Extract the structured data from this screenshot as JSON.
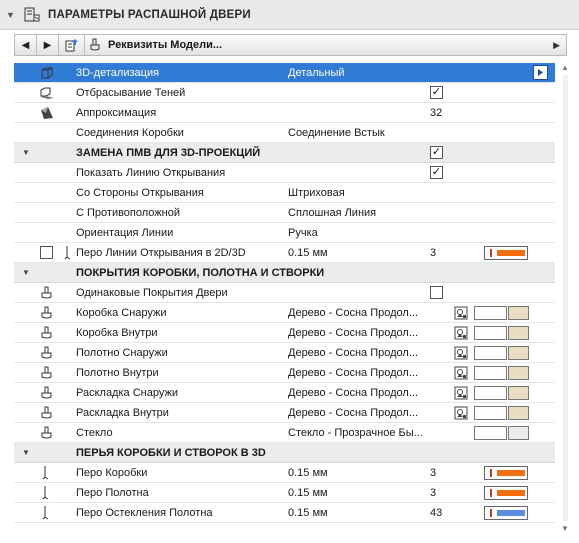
{
  "header": {
    "title": "ПАРАМЕТРЫ РАСПАШНОЙ ДВЕРИ"
  },
  "toolbar": {
    "combo_label": "Реквизиты Модели..."
  },
  "rows": [
    {
      "type": "item",
      "name": "3D-детализация",
      "value": "Детальный",
      "icon": "cube-icon",
      "selected": true
    },
    {
      "type": "item",
      "name": "Отбрасывание Теней",
      "icon": "shadow-cube-icon",
      "checkbox": true
    },
    {
      "type": "item",
      "name": "Аппроксимация",
      "icon": "approximation-icon",
      "num": "32"
    },
    {
      "type": "item",
      "name": "Соединения Коробки",
      "value": "Соединение Встык"
    },
    {
      "type": "section",
      "name": "ЗАМЕНА ПМВ ДЛЯ 3D-ПРОЕКЦИЙ",
      "checkbox": true
    },
    {
      "type": "item",
      "name": "Показать Линию Открывания",
      "checkbox": true
    },
    {
      "type": "item",
      "name": "Со Стороны Открывания",
      "value": "Штриховая"
    },
    {
      "type": "item",
      "name": "С Противоположной",
      "value": "Сплошная Линия"
    },
    {
      "type": "item",
      "name": "Ориентация Линии",
      "value": "Ручка"
    },
    {
      "type": "item",
      "name": "Перо Линии Открывания в 2D/3D",
      "value": "0.15 мм",
      "num": "3",
      "pen_color": "#f07010",
      "icon": "pen-icon",
      "left_checkbox": true
    },
    {
      "type": "section",
      "name": "ПОКРЫТИЯ КОРОБКИ, ПОЛОТНА И СТВОРКИ"
    },
    {
      "type": "item",
      "name": "Одинаковые Покрытия Двери",
      "icon": "paint-brush-icon",
      "checkbox_empty": true
    },
    {
      "type": "item",
      "name": "Коробка Снаружи",
      "value": "Дерево - Сосна Продол...",
      "icon": "paint-brush-icon",
      "surface": true,
      "surface_color": "#e9dcc0"
    },
    {
      "type": "item",
      "name": "Коробка Внутри",
      "value": "Дерево - Сосна Продол...",
      "icon": "paint-brush-icon",
      "surface": true,
      "surface_color": "#e9dcc0"
    },
    {
      "type": "item",
      "name": "Полотно Снаружи",
      "value": "Дерево - Сосна Продол...",
      "icon": "paint-brush-icon",
      "surface": true,
      "surface_color": "#e9dcc0"
    },
    {
      "type": "item",
      "name": "Полотно Внутри",
      "value": "Дерево - Сосна Продол...",
      "icon": "paint-brush-icon",
      "surface": true,
      "surface_color": "#e9dcc0"
    },
    {
      "type": "item",
      "name": "Раскладка Снаружи",
      "value": "Дерево - Сосна Продол...",
      "icon": "paint-brush-icon",
      "surface": true,
      "surface_color": "#e9dcc0"
    },
    {
      "type": "item",
      "name": "Раскладка Внутри",
      "value": "Дерево - Сосна Продол...",
      "icon": "paint-brush-icon",
      "surface": true,
      "surface_color": "#e9dcc0"
    },
    {
      "type": "item",
      "name": "Стекло",
      "value": "Стекло - Прозрачное Бы...",
      "icon": "paint-brush-icon",
      "surface_noicon": true,
      "surface_color": "#ececec"
    },
    {
      "type": "section",
      "name": "ПЕРЬЯ КОРОБКИ И СТВОРОК В 3D"
    },
    {
      "type": "item",
      "name": "Перо Коробки",
      "value": "0.15 мм",
      "num": "3",
      "pen_color": "#f07010",
      "icon": "pen-icon"
    },
    {
      "type": "item",
      "name": "Перо Полотна",
      "value": "0.15 мм",
      "num": "3",
      "pen_color": "#f07010",
      "icon": "pen-icon"
    },
    {
      "type": "item",
      "name": "Перо Остекления Полотна",
      "value": "0.15 мм",
      "num": "43",
      "pen_color": "#5b8ee0",
      "icon": "pen-icon"
    }
  ],
  "colors": {
    "selection": "#2f7bd6",
    "section_bg": "#ececec"
  }
}
